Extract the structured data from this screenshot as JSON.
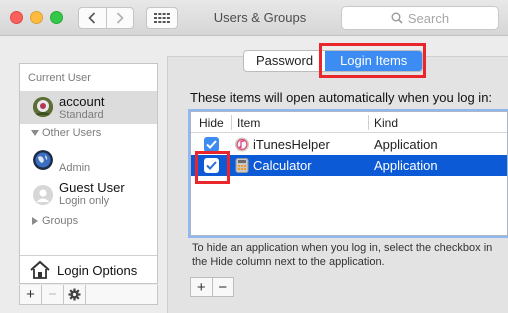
{
  "window": {
    "title": "Users & Groups"
  },
  "search": {
    "placeholder": "Search"
  },
  "sidebar": {
    "current_user_header": "Current User",
    "current_user": {
      "name": "account",
      "role": "Standard"
    },
    "other_users_header": "Other Users",
    "other_users": [
      {
        "name": "",
        "role": "Admin"
      },
      {
        "name": "Guest User",
        "role": "Login only"
      }
    ],
    "groups_header": "Groups",
    "login_options_label": "Login Options"
  },
  "tabs": [
    {
      "label": "Password",
      "active": false
    },
    {
      "label": "Login Items",
      "active": true
    }
  ],
  "login_items": {
    "description": "These items will open automatically when you log in:",
    "columns": [
      "Hide",
      "Item",
      "Kind"
    ],
    "rows": [
      {
        "hide": true,
        "item": "iTunesHelper",
        "kind": "Application",
        "selected": false
      },
      {
        "hide": true,
        "item": "Calculator",
        "kind": "Application",
        "selected": true
      }
    ],
    "hint": "To hide an application when you log in, select the checkbox in the Hide column next to the application."
  },
  "colors": {
    "accent": "#3c8cf4",
    "selection": "#0d5ad6",
    "highlight_box": "#e8262c"
  },
  "icons": [
    "back-icon",
    "forward-icon",
    "grid-icon",
    "search-icon",
    "house-icon",
    "gear-icon",
    "itunes-icon",
    "calculator-icon"
  ]
}
